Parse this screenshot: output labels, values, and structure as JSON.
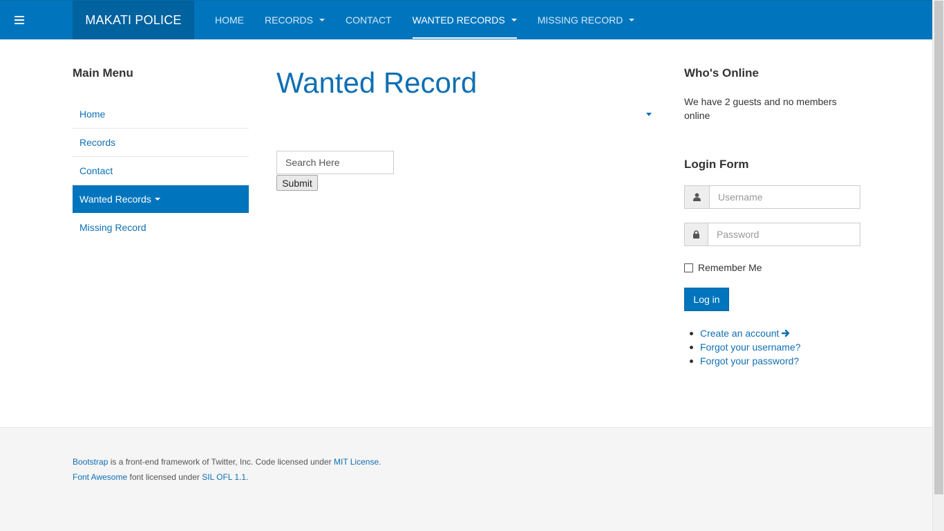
{
  "navbar": {
    "brand": "MAKATI POLICE",
    "items": [
      {
        "label": "HOME"
      },
      {
        "label": "RECORDS"
      },
      {
        "label": "CONTACT"
      },
      {
        "label": "WANTED RECORDS"
      },
      {
        "label": "MISSING RECORD"
      }
    ],
    "active": "WANTED RECORDS",
    "color": "#0075bd"
  },
  "left_sidebar": {
    "title": "Main Menu",
    "items": [
      {
        "label": "Home"
      },
      {
        "label": "Records"
      },
      {
        "label": "Contact"
      },
      {
        "label": "Wanted Records"
      },
      {
        "label": "Missing Record"
      }
    ],
    "active": "Wanted Records"
  },
  "main": {
    "title": "Wanted Record",
    "search_placeholder": "Search Here",
    "submit_label": "Submit"
  },
  "right_sidebar": {
    "online_title": "Who's Online",
    "online_text": "We have 2 guests and no members online",
    "login_title": "Login Form",
    "username_placeholder": "Username",
    "password_placeholder": "Password",
    "remember_label": "Remember Me",
    "login_button": "Log in",
    "links": {
      "create_account": "Create an account",
      "forgot_username": "Forgot your username?",
      "forgot_password": "Forgot your password?"
    }
  },
  "footer": {
    "line1": {
      "link1": "Bootstrap",
      "text1": " is a front-end framework of Twitter, Inc. Code licensed under ",
      "link2": "MIT License",
      "text2": "."
    },
    "line2": {
      "link1": "Font Awesome",
      "text1": " font licensed under ",
      "link2": "SIL OFL 1.1",
      "text2": "."
    }
  },
  "icons": {
    "menu": "hamburger-icon",
    "user": "user-icon",
    "lock": "lock-icon",
    "arrow": "arrow-right-icon"
  }
}
